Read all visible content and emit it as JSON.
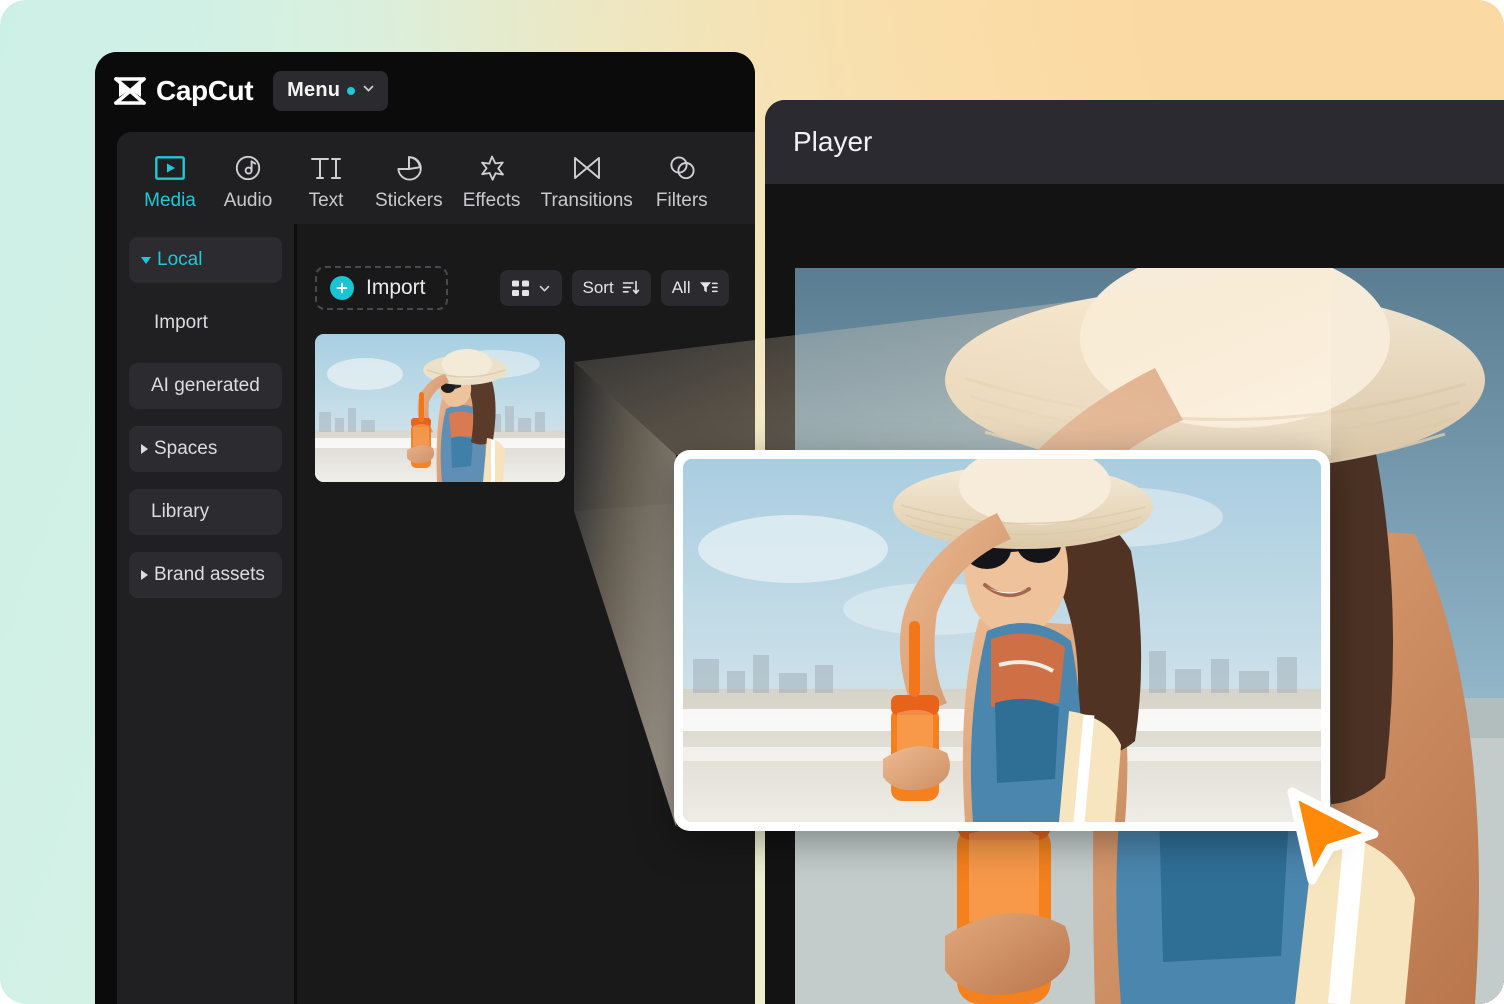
{
  "app": {
    "brand": "CapCut",
    "logo_icon": "capcut-logo-icon",
    "menu_label": "Menu",
    "menu_dot_icon": "status-dot-icon",
    "menu_chevron_icon": "chevron-down-icon"
  },
  "tabs": [
    {
      "label": "Media",
      "icon": "media-play-frame-icon",
      "active": true
    },
    {
      "label": "Audio",
      "icon": "audio-note-icon",
      "active": false
    },
    {
      "label": "Text",
      "icon": "text-ti-icon",
      "active": false
    },
    {
      "label": "Stickers",
      "icon": "sticker-drop-icon",
      "active": false
    },
    {
      "label": "Effects",
      "icon": "effects-sparkle-icon",
      "active": false
    },
    {
      "label": "Transitions",
      "icon": "transitions-bowtie-icon",
      "active": false
    },
    {
      "label": "Filters",
      "icon": "filters-circles-icon",
      "active": false
    }
  ],
  "sidebar": {
    "items": [
      {
        "label": "Local",
        "caret": "down",
        "active": true,
        "filled": true
      },
      {
        "label": "Import",
        "caret": "none",
        "active": false,
        "filled": false
      },
      {
        "label": "AI generated",
        "caret": "none",
        "active": false,
        "filled": true
      },
      {
        "label": "Spaces",
        "caret": "right",
        "active": false,
        "filled": true
      },
      {
        "label": "Library",
        "caret": "none",
        "active": false,
        "filled": true
      },
      {
        "label": "Brand assets",
        "caret": "right",
        "active": false,
        "filled": true
      }
    ]
  },
  "content_toolbar": {
    "import_label": "Import",
    "import_plus_icon": "plus-circle-icon",
    "view_icon": "grid-view-icon",
    "view_chevron_icon": "chevron-down-icon",
    "sort_label": "Sort",
    "sort_icon": "sort-lines-icon",
    "filter_label": "All",
    "filter_icon": "filter-funnel-icon"
  },
  "media": {
    "items": [
      {
        "name": "beach-woman-drink-thumbnail"
      }
    ]
  },
  "player": {
    "title": "Player",
    "preview_name": "beach-woman-drink-preview"
  },
  "magnifier": {
    "card_name": "magnified-media-preview",
    "cursor_icon": "cursor-arrow-icon"
  },
  "colors": {
    "accent_cyan": "#21c8d6",
    "cursor_orange": "#FF8A0A",
    "panel_dark": "#202023",
    "content_dark": "#191919",
    "window_black": "#0b0b0c",
    "player_header": "#2a2a30",
    "backdrop_mint": "#cdf0e6",
    "backdrop_peach": "#fbd9a2"
  }
}
